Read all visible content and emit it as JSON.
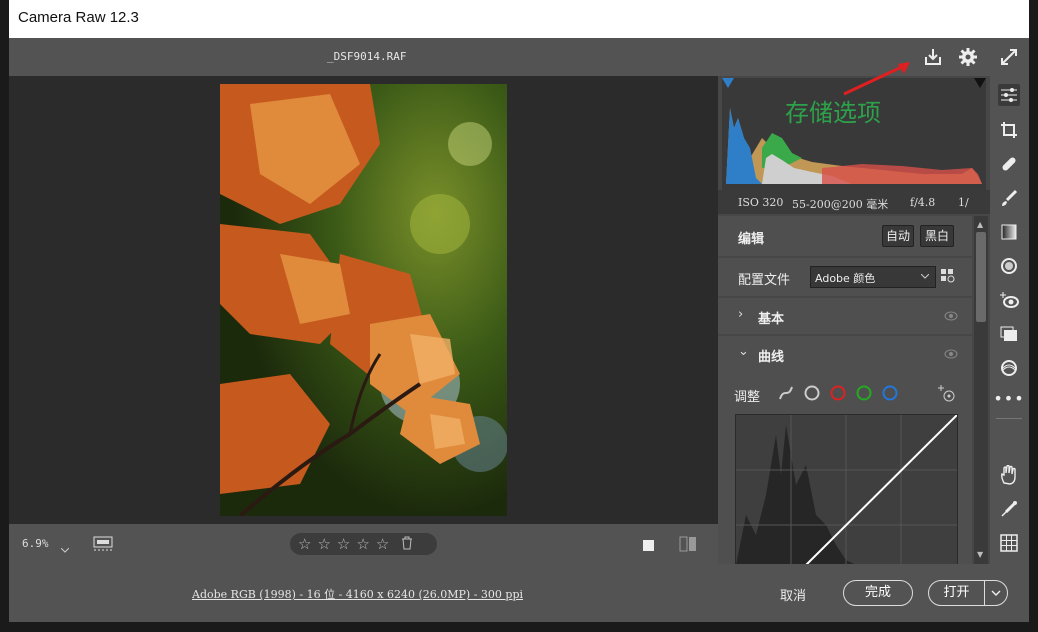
{
  "window": {
    "title": "Camera Raw 12.3"
  },
  "header": {
    "filename": "_DSF9014.RAF"
  },
  "annotation": {
    "text": "存储选项",
    "color": "#2da24a",
    "arrow_color": "#e02020"
  },
  "metadata": {
    "iso": "ISO 320",
    "lens": "55-200@200 毫米",
    "aperture": "f/4.8",
    "shutter": "1/"
  },
  "edit": {
    "title": "编辑",
    "auto_label": "自动",
    "bw_label": "黑白"
  },
  "profile": {
    "label": "配置文件",
    "value": "Adobe 颜色"
  },
  "panels": {
    "basic": "基本",
    "curve": "曲线"
  },
  "curve": {
    "adjust_label": "调整"
  },
  "canvas_bar": {
    "zoom": "6.9%",
    "rating_stars": 5
  },
  "footer": {
    "info": "Adobe RGB (1998) - 16 位 - 4160 x 6240 (26.0MP) - 300 ppi",
    "cancel": "取消",
    "done": "完成",
    "open": "打开"
  },
  "colors": {
    "accent": "#2da24a",
    "panel": "#474747",
    "bar": "#535353"
  }
}
